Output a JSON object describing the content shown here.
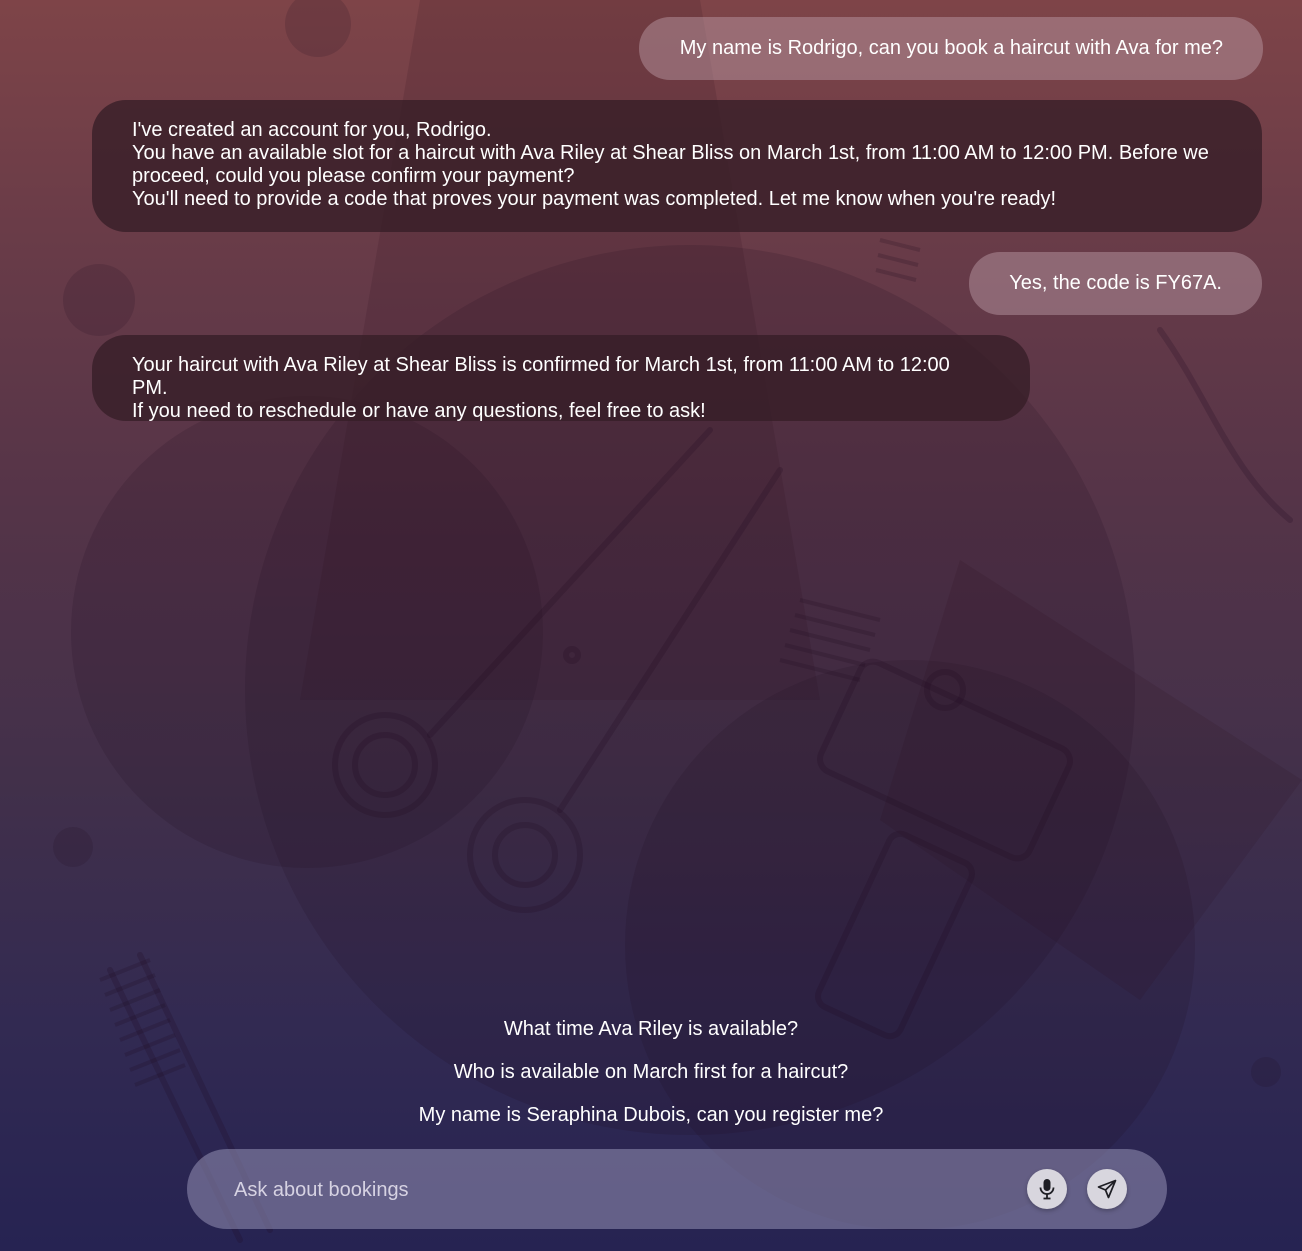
{
  "conversation": {
    "messages": [
      {
        "role": "user",
        "lines": [
          "My name is Rodrigo, can you book a haircut with Ava for me?"
        ]
      },
      {
        "role": "assistant",
        "lines": [
          "I've created an account for you, Rodrigo.",
          "You have an available slot for a haircut with Ava Riley at Shear Bliss on March 1st, from 11:00 AM to 12:00 PM. Before we proceed, could you please confirm your payment?",
          "You'll need to provide a code that proves your payment was completed. Let me know when you're ready!"
        ]
      },
      {
        "role": "user",
        "lines": [
          "Yes, the code is FY67A."
        ]
      },
      {
        "role": "assistant",
        "lines": [
          "Your haircut with Ava Riley at Shear Bliss is confirmed for March 1st, from 11:00 AM to 12:00 PM.",
          "If you need to reschedule or have any questions, feel free to ask!"
        ]
      }
    ]
  },
  "suggestions": [
    "What time Ava Riley is available?",
    "Who is available on March first for a haircut?",
    "My name is Seraphina Dubois, can you register me?"
  ],
  "composer": {
    "placeholder": "Ask about bookings",
    "value": "",
    "mic_icon": "microphone-icon",
    "send_icon": "send-icon"
  },
  "colors": {
    "background_top": "#7e4448",
    "background_bottom": "#262352",
    "user_bubble": "#a88790",
    "assistant_bubble": "#3c2129",
    "input_bar": "#7b7696"
  }
}
